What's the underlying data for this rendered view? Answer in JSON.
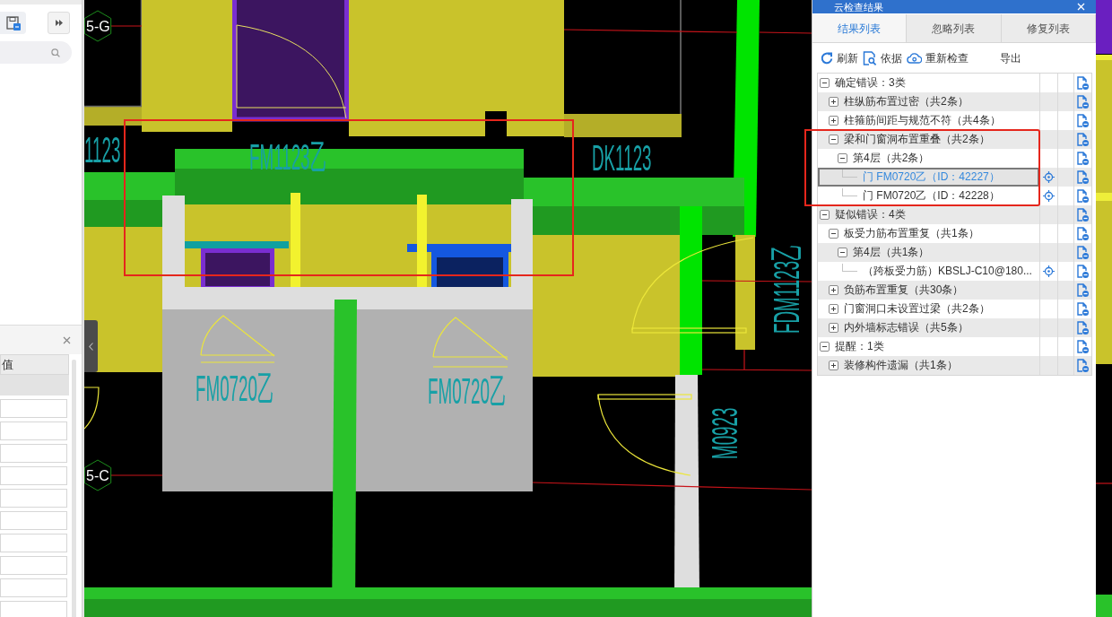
{
  "left_panel": {
    "property_table": {
      "columns": [
        "值"
      ]
    }
  },
  "cad_view": {
    "axis_labels": [
      "5-G",
      "5-C"
    ],
    "door_labels": [
      "1123",
      "FM1123乙",
      "DK1123",
      "FM0720乙",
      "FM0720乙",
      "FDM1123乙",
      "M0923"
    ]
  },
  "check_panel": {
    "title": "云检查结果",
    "tabs": [
      {
        "label": "结果列表",
        "selected": true
      },
      {
        "label": "忽略列表",
        "selected": false
      },
      {
        "label": "修复列表",
        "selected": false
      }
    ],
    "toolbar": [
      {
        "kind": "refresh",
        "label": "刷新"
      },
      {
        "kind": "basis",
        "label": "依据"
      },
      {
        "kind": "recheck",
        "label": "重新检查"
      },
      {
        "kind": "export",
        "label": "导出"
      }
    ],
    "tree": [
      {
        "kind": "group",
        "label": "确定错误：3类",
        "expanded": true,
        "selected": false,
        "children": [
          {
            "kind": "group",
            "label": "柱纵筋布置过密（共2条）",
            "expanded": false,
            "selected": false
          },
          {
            "kind": "group",
            "label": "柱箍筋间距与规范不符（共4条）",
            "expanded": false,
            "selected": false
          },
          {
            "kind": "group",
            "label": "梁和门窗洞布置重叠（共2条）",
            "expanded": true,
            "selected": false,
            "children": [
              {
                "kind": "group",
                "label": "第4层（共2条）",
                "expanded": true,
                "selected": false,
                "children": [
                  {
                    "kind": "item",
                    "label": "门 FM0720乙（ID：42227）",
                    "selected": true
                  },
                  {
                    "kind": "item",
                    "label": "门 FM0720乙（ID：42228）",
                    "selected": false
                  }
                ]
              }
            ]
          }
        ]
      },
      {
        "kind": "group",
        "label": "疑似错误：4类",
        "expanded": true,
        "selected": false,
        "children": [
          {
            "kind": "group",
            "label": "板受力筋布置重复（共1条）",
            "expanded": true,
            "selected": false,
            "children": [
              {
                "kind": "group",
                "label": "第4层（共1条）",
                "expanded": true,
                "selected": false,
                "children": [
                  {
                    "kind": "item",
                    "label": "（跨板受力筋）KBSLJ-C10@180...",
                    "selected": false
                  }
                ]
              }
            ]
          },
          {
            "kind": "group",
            "label": "负筋布置重复（共30条）",
            "expanded": false,
            "selected": false
          },
          {
            "kind": "group",
            "label": "门窗洞口未设置过梁（共2条）",
            "expanded": false,
            "selected": false
          },
          {
            "kind": "group",
            "label": "内外墙标志错误（共5条）",
            "expanded": false,
            "selected": false
          }
        ]
      },
      {
        "kind": "group",
        "label": "提醒：1类",
        "expanded": true,
        "selected": false,
        "children": [
          {
            "kind": "group",
            "label": "装修构件遗漏（共1条）",
            "expanded": false,
            "selected": false
          }
        ]
      }
    ]
  }
}
